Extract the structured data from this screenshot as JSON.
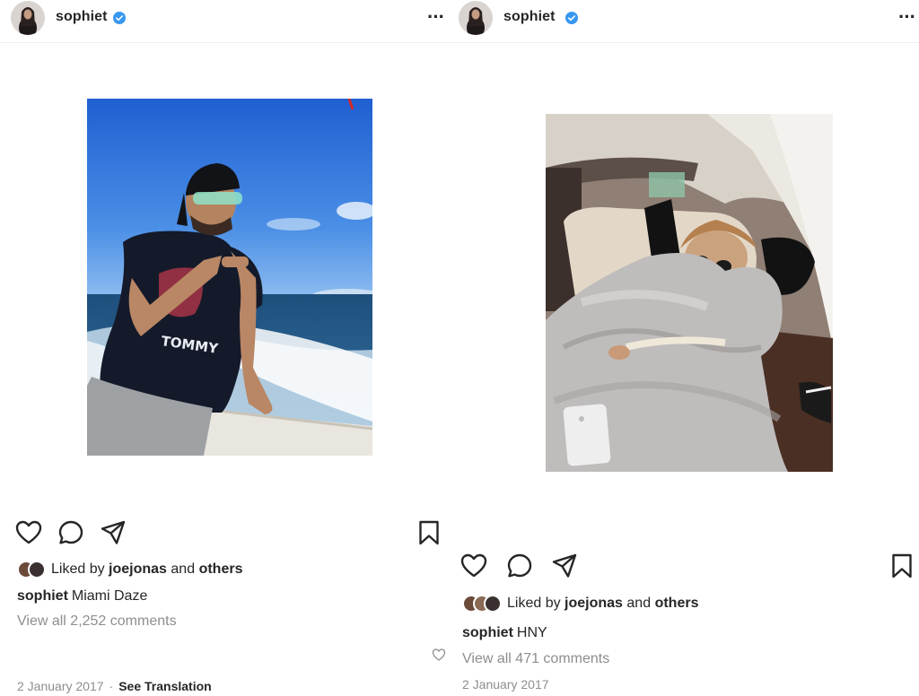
{
  "posts": [
    {
      "username": "sophiet",
      "liked_by_prefix": "Liked by",
      "liked_by_user": "joejonas",
      "liked_by_and": "and",
      "liked_by_others": "others",
      "caption_user": "sophiet",
      "caption_text": "Miami Daze",
      "view_comments": "View all 2,252 comments",
      "date": "2 January 2017",
      "separator": "·",
      "see_translation": "See Translation"
    },
    {
      "username": "sophiet",
      "liked_by_prefix": "Liked by",
      "liked_by_user": "joejonas",
      "liked_by_and": "and",
      "liked_by_others": "others",
      "caption_user": "sophiet",
      "caption_text": "HNY",
      "view_comments": "View all 471 comments",
      "date": "2 January 2017"
    }
  ],
  "colors": {
    "verified_blue": "#3897f0",
    "text": "#262626",
    "muted": "#8e8e8e"
  },
  "icons": [
    "heart-icon",
    "comment-icon",
    "share-icon",
    "bookmark-icon",
    "more-icon",
    "verified-badge-icon"
  ]
}
